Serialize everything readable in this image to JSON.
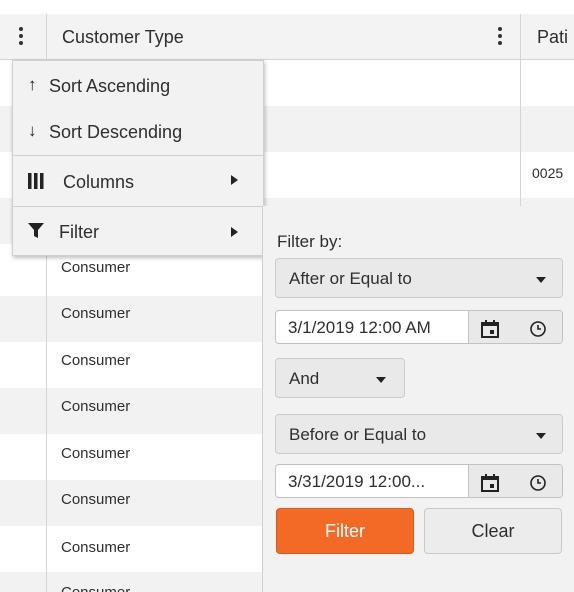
{
  "grid": {
    "columns": [
      {
        "title": "Customer Type"
      },
      {
        "title": "Pati"
      }
    ],
    "rows": [
      {
        "customer_type": "",
        "second": ""
      },
      {
        "customer_type": "",
        "second": ""
      },
      {
        "customer_type": "",
        "second": "0025"
      },
      {
        "customer_type": "",
        "second": ""
      },
      {
        "customer_type": "Consumer",
        "second": ""
      },
      {
        "customer_type": "Consumer",
        "second": ""
      },
      {
        "customer_type": "Consumer",
        "second": ""
      },
      {
        "customer_type": "Consumer",
        "second": ""
      },
      {
        "customer_type": "Consumer",
        "second": ""
      },
      {
        "customer_type": "Consumer",
        "second": ""
      },
      {
        "customer_type": "Consumer",
        "second": ""
      },
      {
        "customer_type": "Consumer",
        "second": ""
      }
    ]
  },
  "column_menu": {
    "sort_ascending": {
      "icon": "arrow-up-icon",
      "glyph": "↑",
      "label": "Sort Ascending"
    },
    "sort_descending": {
      "icon": "arrow-down-icon",
      "glyph": "↓",
      "label": "Sort Descending"
    },
    "columns": {
      "icon": "columns-icon",
      "label": "Columns"
    },
    "filter": {
      "icon": "funnel-icon",
      "label": "Filter"
    }
  },
  "filter_panel": {
    "label": "Filter by:",
    "operator1": "After or Equal to",
    "value1": "3/1/2019 12:00 AM",
    "logic": "And",
    "operator2": "Before or Equal to",
    "value2": "3/31/2019 12:00...",
    "filter_button": "Filter",
    "clear_button": "Clear"
  },
  "colors": {
    "accent": "#f36a26",
    "header_bg": "#f3f3f3",
    "menu_bg": "#f2f2f2",
    "alt_row": "#f2f2f2"
  }
}
